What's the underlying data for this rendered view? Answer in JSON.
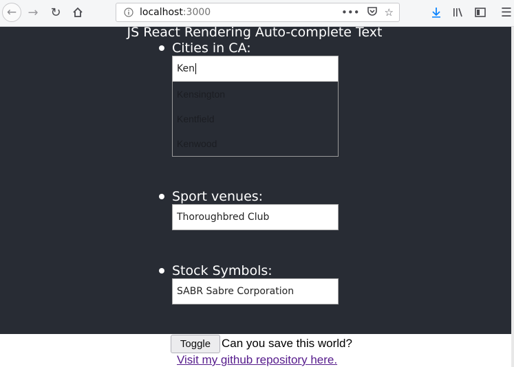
{
  "browser": {
    "url_host": "localhost",
    "url_port": ":3000",
    "icons": [
      "back-icon",
      "forward-icon",
      "reload-icon",
      "home-icon",
      "info-icon",
      "more-icon",
      "pocket-icon",
      "bookmark-star-icon",
      "download-icon",
      "library-icon",
      "sidebar-icon",
      "menu-icon"
    ]
  },
  "page": {
    "title": "JS React Rendering Auto-complete Text",
    "background": "#282c34",
    "sections": [
      {
        "label": "Cities in CA:",
        "input_value": "Ken",
        "suggestions": [
          "Kensington",
          "Kentfield",
          "Kenwood"
        ]
      },
      {
        "label": "Sport venues:",
        "input_value": "Thoroughbred Club"
      },
      {
        "label": "Stock Symbols:",
        "input_value": "SABR Sabre Corporation"
      }
    ]
  },
  "footer": {
    "toggle_label": "Toggle",
    "text": "Can you save this world?",
    "link_text": "Visit my github repository here.",
    "link_color": "#551a8b"
  }
}
